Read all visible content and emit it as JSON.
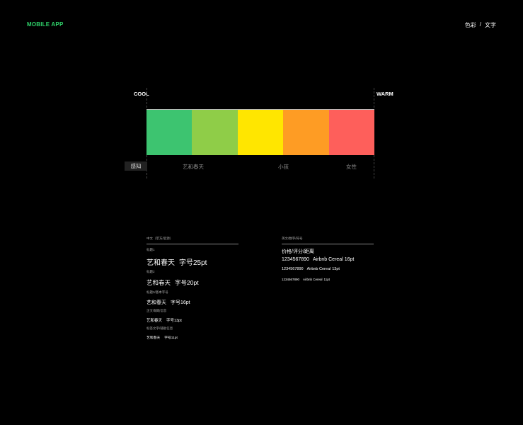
{
  "header": {
    "brand": "MOBILE APP",
    "crumb": {
      "color": "色彩",
      "sep": "/",
      "text": "文字"
    }
  },
  "scale": {
    "cool_label": "COOL",
    "warm_label": "WARM",
    "swatches": [
      "#3dc470",
      "#8fcd48",
      "#ffe600",
      "#fe9c24",
      "#fe5f5b"
    ],
    "perception_tag": "感知",
    "perceptions": [
      "艺和春天",
      "小孩",
      "女性"
    ]
  },
  "typography": {
    "chinese": {
      "heading": "中文（苹方/思源）",
      "samples": [
        {
          "caption": "标题1",
          "text": "艺和春天",
          "size_label": "字号25pt"
        },
        {
          "caption": "标题2",
          "text": "艺和春天",
          "size_label": "字号20pt"
        },
        {
          "caption": "标题3/基本字号",
          "text": "艺和春天",
          "size_label": "字号16pt"
        },
        {
          "caption": "正文/辅助信息",
          "text": "艺和春天",
          "size_label": "字号13pt"
        },
        {
          "caption": "标签文字/辅助信息",
          "text": "艺和春天",
          "size_label": "字号11pt"
        }
      ]
    },
    "english": {
      "heading": "英文/数字/符号",
      "subheading": "价格/评分/距离",
      "samples": [
        {
          "digits": "1234567890",
          "font_name": "Airbnb Cereal",
          "size_label": "16pt"
        },
        {
          "digits": "1234567890",
          "font_name": "Airbnb Cereal",
          "size_label": "13pt"
        },
        {
          "digits": "1234567890",
          "font_name": "Airbnb Cereal",
          "size_label": "11pt"
        }
      ]
    }
  }
}
